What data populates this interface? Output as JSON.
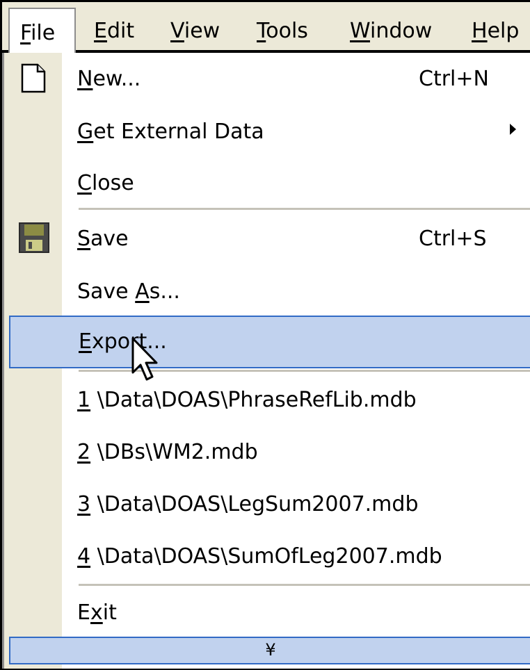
{
  "menubar": {
    "items": [
      {
        "accel": "F",
        "rest": "ile"
      },
      {
        "accel": "E",
        "rest": "dit"
      },
      {
        "accel": "V",
        "rest": "iew"
      },
      {
        "accel": "T",
        "rest": "ools"
      },
      {
        "accel": "W",
        "rest": "indow"
      },
      {
        "accel": "H",
        "rest": "elp"
      }
    ]
  },
  "file_menu": {
    "new": {
      "accel": "N",
      "rest": "ew...",
      "shortcut": "Ctrl+N",
      "icon": "new-document-icon"
    },
    "get_external_data": {
      "accel": "G",
      "rest": "et External Data",
      "submenu": true
    },
    "close": {
      "accel": "C",
      "rest": "lose"
    },
    "save": {
      "accel": "S",
      "rest": "ave",
      "shortcut": "Ctrl+S",
      "icon": "floppy-disk-icon"
    },
    "save_as": {
      "pre": "Save ",
      "accel": "A",
      "rest": "s..."
    },
    "export": {
      "accel": "E",
      "rest": "xport...",
      "highlighted": true
    },
    "recent_files": [
      {
        "num": "1",
        "path": " \\Data\\DOAS\\PhraseRefLib.mdb"
      },
      {
        "num": "2",
        "path": " \\DBs\\WM2.mdb"
      },
      {
        "num": "3",
        "path": " \\Data\\DOAS\\LegSum2007.mdb"
      },
      {
        "num": "4",
        "path": " \\Data\\DOAS\\SumOfLeg2007.mdb"
      }
    ],
    "exit": {
      "pre": "E",
      "accel": "x",
      "rest": "it"
    },
    "expand_chevron": "¥"
  },
  "colors": {
    "menu_bg": "#ffffff",
    "icon_strip": "#ece9d8",
    "highlight_fill": "#c1d2ee",
    "highlight_border": "#316ac5",
    "separator": "#c5c2b8",
    "background": "#000000"
  }
}
